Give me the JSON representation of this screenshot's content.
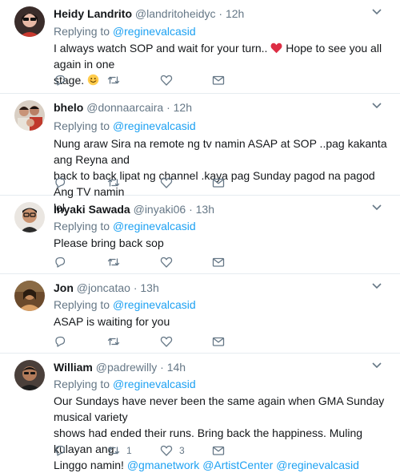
{
  "tweets": [
    {
      "name": "Heidy Landrito",
      "handle": "@landritoheidyc",
      "time": "12h",
      "replying_label": "Replying to",
      "replying_to": "@reginevalcasid",
      "text_part1": "I always watch SOP and wait for your turn..",
      "text_part2": "Hope to see you all again in one",
      "text_part3": "stage.",
      "reply_count": "",
      "retweet_count": "",
      "like_count": ""
    },
    {
      "name": "bhelo",
      "handle": "@donnaarcaira",
      "time": "12h",
      "replying_label": "Replying to",
      "replying_to": "@reginevalcasid",
      "line1": "Nung araw Sira na remote ng tv namin ASAP at SOP ..pag kakanta ang Reyna and",
      "line2": "back to back lipat ng channel .kaya pag Sunday pagod na pagod Ang TV namin",
      "line3": "lol",
      "reply_count": "",
      "retweet_count": "",
      "like_count": ""
    },
    {
      "name": "Inyaki Sawada",
      "handle": "@inyaki06",
      "time": "13h",
      "replying_label": "Replying to",
      "replying_to": "@reginevalcasid",
      "line1": "Please bring back sop",
      "reply_count": "",
      "retweet_count": "",
      "like_count": ""
    },
    {
      "name": "Jon",
      "handle": "@joncatao",
      "time": "13h",
      "replying_label": "Replying to",
      "replying_to": "@reginevalcasid",
      "line1": "ASAP is waiting for you",
      "reply_count": "",
      "retweet_count": "",
      "like_count": ""
    },
    {
      "name": "William",
      "handle": "@padrewilly",
      "time": "14h",
      "replying_label": "Replying to",
      "replying_to": "@reginevalcasid",
      "line1": "Our Sundays have never been the same again when GMA Sunday musical variety",
      "line2": "shows had ended their runs. Bring back the happiness. Muling kulayan ang",
      "line3_prefix": "Linggo namin!",
      "mention1": "@gmanetwork",
      "mention2": "@ArtistCenter",
      "mention3": "@reginevalcasid",
      "reply_count": "",
      "retweet_count": "1",
      "like_count": "3"
    }
  ],
  "separator": "·",
  "icons": {
    "reply": "reply-icon",
    "retweet": "retweet-icon",
    "like": "heart-icon",
    "dm": "envelope-icon",
    "more": "chevron-down-icon"
  },
  "colors": {
    "link": "#1da1f2",
    "muted": "#657786",
    "heart": "#e0245e",
    "divider": "#e6ecf0"
  }
}
